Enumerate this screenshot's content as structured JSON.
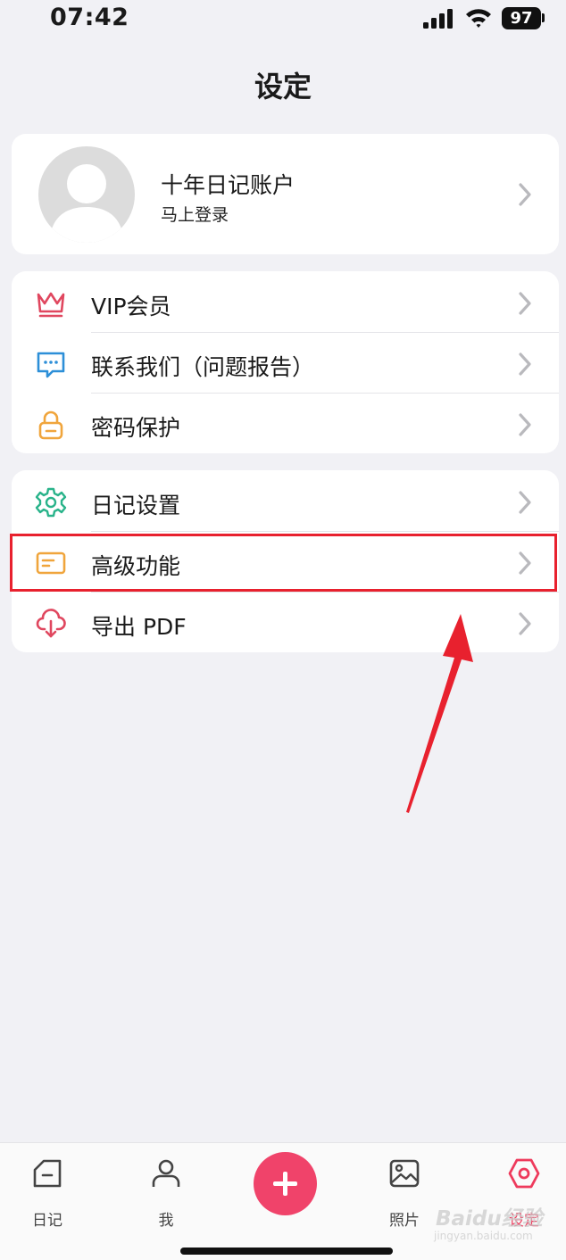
{
  "status": {
    "time": "07:42",
    "battery": "97"
  },
  "title": "设定",
  "profile": {
    "name": "十年日记账户",
    "subtitle": "马上登录"
  },
  "group1": [
    {
      "label": "VIP会员",
      "icon": "crown-icon",
      "color": "#e0475f"
    },
    {
      "label": "联系我们（问题报告）",
      "icon": "chat-icon",
      "color": "#2d8fd8"
    },
    {
      "label": "密码保护",
      "icon": "lock-icon",
      "color": "#f0a53c"
    }
  ],
  "group2": [
    {
      "label": "日记设置",
      "icon": "gear-icon",
      "color": "#29b38a"
    },
    {
      "label": "高级功能",
      "icon": "card-icon",
      "color": "#f0a53c"
    },
    {
      "label": "导出 PDF",
      "icon": "cloud-download-icon",
      "color": "#e0475f"
    }
  ],
  "tabs": [
    {
      "label": "日记",
      "icon": "diary-icon"
    },
    {
      "label": "我",
      "icon": "person-icon"
    },
    {
      "label": "照片",
      "icon": "photo-icon"
    },
    {
      "label": "设定",
      "icon": "settings-hex-icon",
      "active": true
    }
  ],
  "colors": {
    "accent": "#f0436a",
    "highlight": "#e8212e"
  },
  "watermark": {
    "main": "Baidu经验",
    "sub": "jingyan.baidu.com"
  }
}
